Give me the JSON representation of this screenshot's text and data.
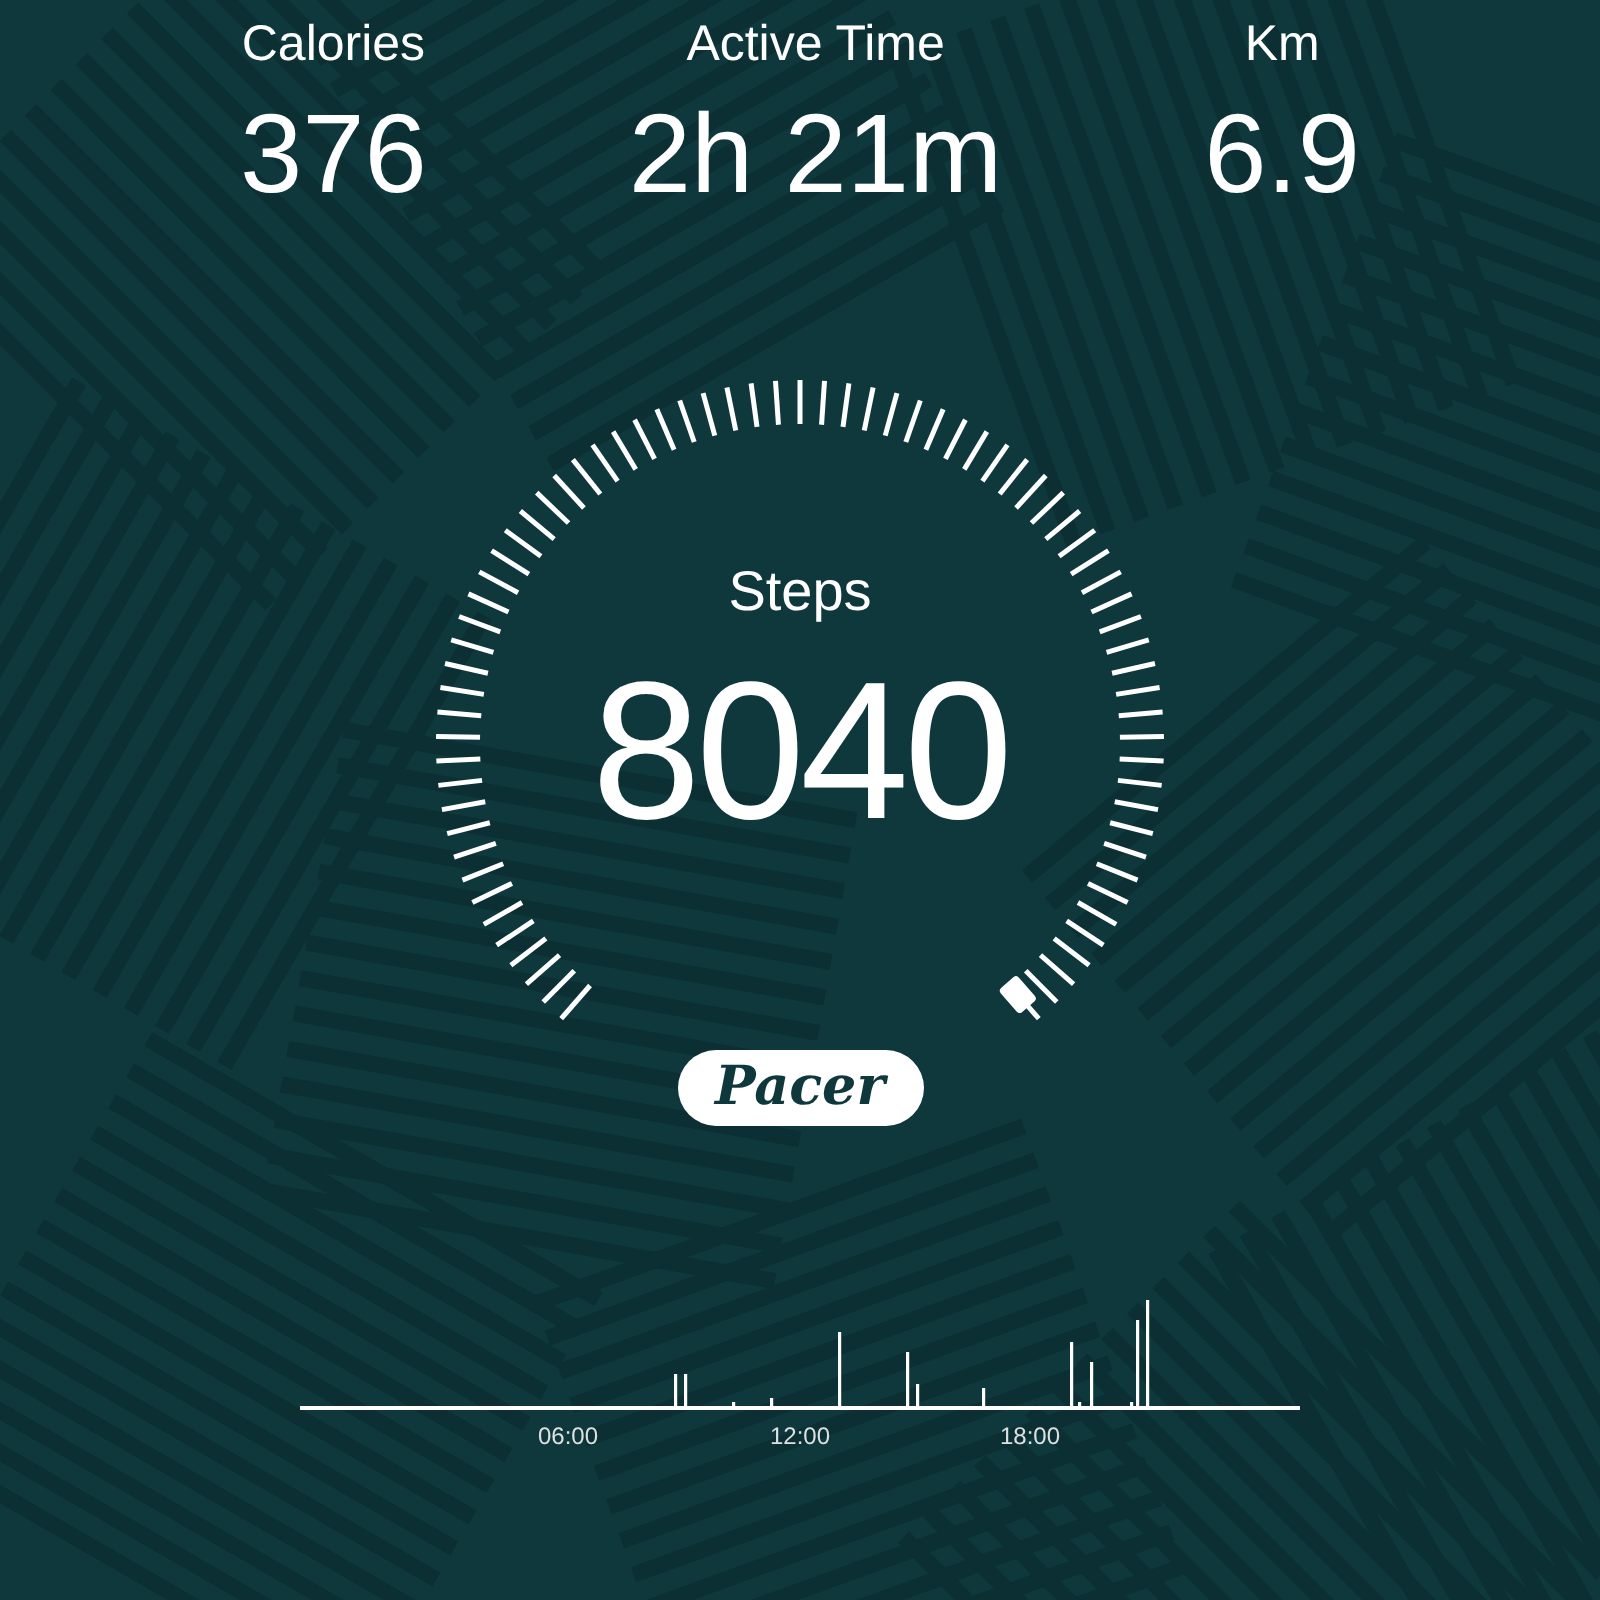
{
  "stats": [
    {
      "label": "Calories",
      "value": "376"
    },
    {
      "label": "Active Time",
      "value": "2h 21m"
    },
    {
      "label": "Km",
      "value": "6.9"
    }
  ],
  "gauge": {
    "label": "Steps",
    "value": "8040"
  },
  "brand": "Pacer",
  "activity_chart": {
    "x_labels": [
      "06:00",
      "12:00",
      "18:00"
    ]
  }
}
